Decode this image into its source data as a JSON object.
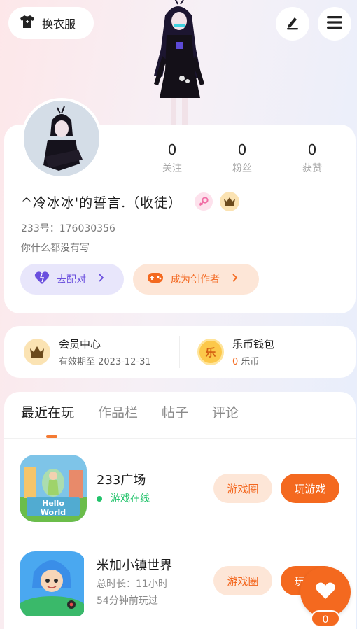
{
  "header": {
    "wear_label": "换衣服"
  },
  "profile": {
    "stats": [
      {
        "num": "0",
        "label": "关注"
      },
      {
        "num": "0",
        "label": "粉丝"
      },
      {
        "num": "0",
        "label": "获赞"
      }
    ],
    "name": "^冷冰冰'的誓言.（收徒）",
    "uid": "233号：176030356",
    "bio": "你什么都没有写",
    "match_label": "去配对",
    "creator_label": "成为创作者"
  },
  "vip": {
    "title": "会员中心",
    "sub": "有效期至 2023-12-31",
    "wallet_title": "乐币钱包",
    "wallet_amount": "0",
    "wallet_unit": "乐币",
    "wallet_icon_char": "乐"
  },
  "tabs": [
    "最近在玩",
    "作品栏",
    "帖子",
    "评论"
  ],
  "games": [
    {
      "name": "233广场",
      "status": "游戏在线",
      "circle": "游戏圈",
      "play": "玩游戏"
    },
    {
      "name": "米加小镇世界",
      "duration": "总时长：11小时",
      "last": "54分钟前玩过",
      "circle": "游戏圈",
      "play": "玩游戏"
    }
  ],
  "fab": {
    "count": "0"
  },
  "colors": {
    "accent": "#f4691f",
    "purple": "#6a4fde",
    "green": "#22c36b"
  }
}
